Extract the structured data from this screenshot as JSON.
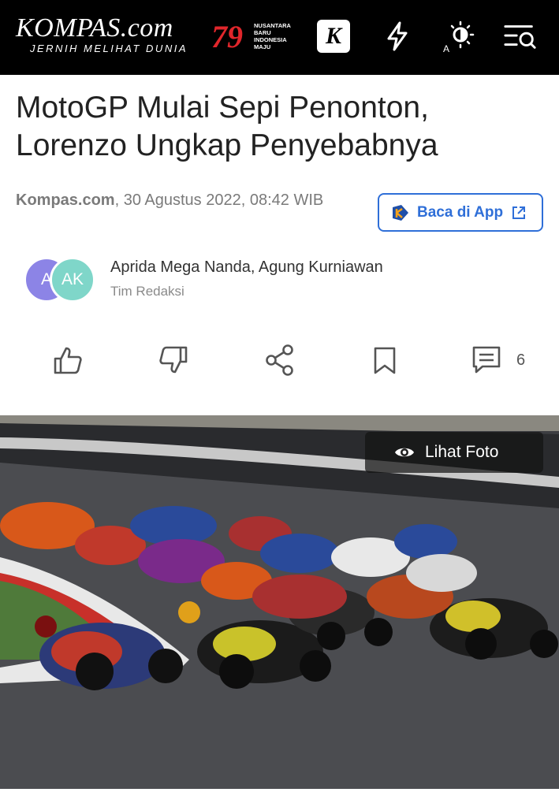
{
  "header": {
    "brand_name": "KOMPAS",
    "brand_domain": ".com",
    "tagline": "JERNIH MELIHAT DUNIA",
    "anniversary_number": "79",
    "anniversary_text": [
      "NUSANTARA",
      "BARU",
      "INDONESIA",
      "MAJU"
    ],
    "k_badge": "K",
    "icons": [
      "bolt-icon",
      "theme-toggle-icon",
      "menu-search-icon"
    ]
  },
  "article": {
    "title": "MotoGP Mulai Sepi Penonton, Lorenzo Ungkap Penyebabnya",
    "source": "Kompas.com",
    "date": ", 30 Agustus 2022, 08:42 WIB"
  },
  "app_button": {
    "label": "Baca di App"
  },
  "authors": {
    "avatar1_initials": "A",
    "avatar2_initials": "AK",
    "names": "Aprida Mega Nanda, Agung Kurniawan",
    "role": "Tim Redaksi"
  },
  "actions": {
    "comment_count": "6"
  },
  "photo": {
    "button_label": "Lihat Foto"
  },
  "colors": {
    "header_bg": "#000000",
    "accent_blue": "#2f6fd8",
    "anniversary_red": "#e0262b"
  }
}
